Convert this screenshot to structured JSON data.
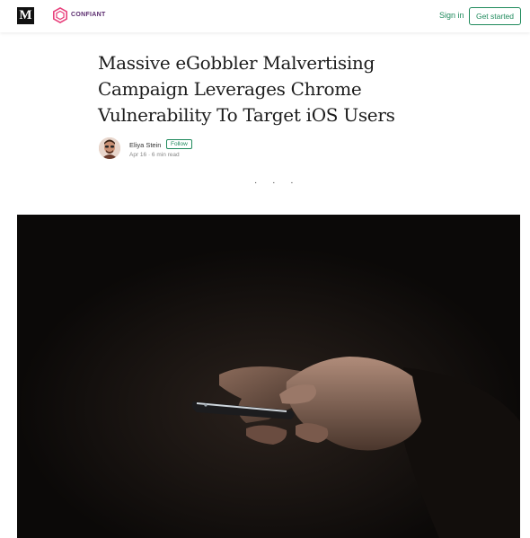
{
  "header": {
    "logo_letter": "M",
    "publication_name": "CONFIANT",
    "signin_label": "Sign in",
    "get_started_label": "Get started"
  },
  "article": {
    "title": "Massive eGobbler Malvertising Campaign Leverages Chrome Vulnerability To Target iOS Users",
    "author_name": "Eliya Stein",
    "follow_label": "Follow",
    "meta": "Apr 16 · 6 min read",
    "separator": "· · ·"
  },
  "colors": {
    "accent": "#1f8a5c",
    "publication_logo": "#e8417c",
    "hero_background": "#0b0908"
  },
  "icons": {
    "logo": "medium-logo-icon",
    "publication": "confiant-logo-icon"
  }
}
